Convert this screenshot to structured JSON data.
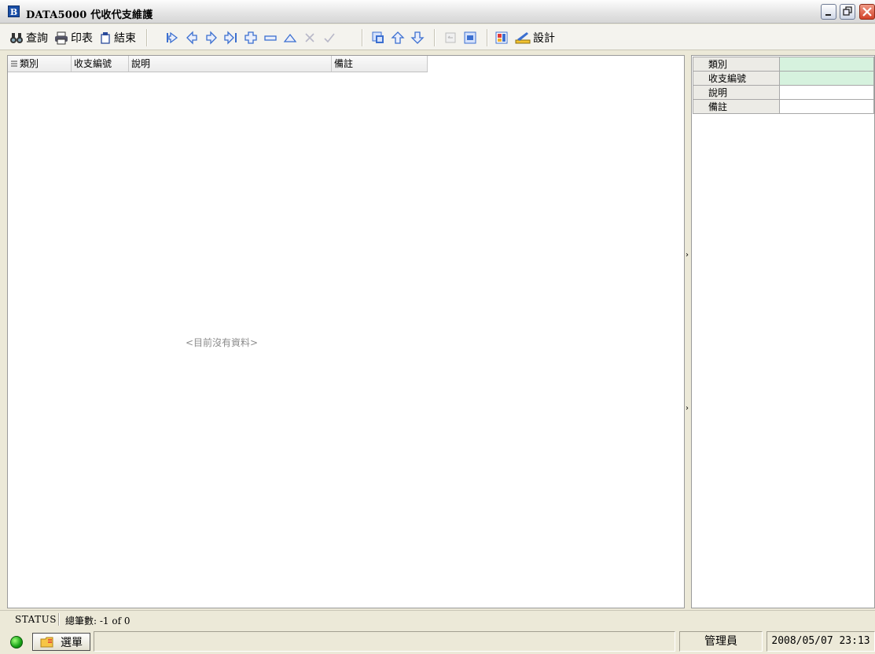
{
  "window": {
    "app_letter": "B",
    "title": "DATA5000 代收代支維護"
  },
  "toolbar": {
    "query_label": "查詢",
    "print_label": "印表",
    "close_label": "結束",
    "design_label": "設計"
  },
  "grid": {
    "columns": [
      "類別",
      "收支編號",
      "說明",
      "備註"
    ],
    "empty_message": "<目前沒有資料>"
  },
  "detail": {
    "fields": [
      {
        "label": "類別",
        "value": ""
      },
      {
        "label": "收支編號",
        "value": ""
      },
      {
        "label": "說明",
        "value": ""
      },
      {
        "label": "備註",
        "value": ""
      }
    ]
  },
  "statusbar": {
    "label": "STATUS",
    "count": "總筆數:  -1 of 0"
  },
  "bottombar": {
    "menu_label": "選單",
    "user": "管理員",
    "datetime": "2008/05/07 23:13"
  },
  "colors": {
    "key_field_bg": "#d6f2de",
    "title_icon": "#1a4fa8",
    "close_button": "#d2432a"
  }
}
